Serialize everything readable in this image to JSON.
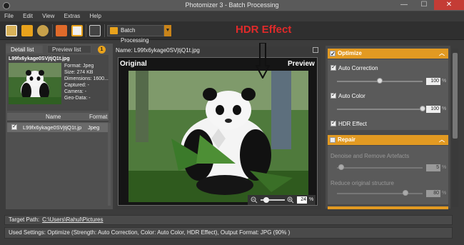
{
  "window": {
    "title": "Photomizer 3 - Batch Processing",
    "minimize": "—",
    "maximize": "☐",
    "close": "✕"
  },
  "menu": [
    "File",
    "Edit",
    "View",
    "Extras",
    "Help"
  ],
  "toolbar": {
    "batch_label": "Batch Processing",
    "batch_arrow": "▼"
  },
  "annotation": {
    "hdr_text": "HDR Effect"
  },
  "left_panel": {
    "tabs": [
      "Detail list",
      "Preview list"
    ],
    "badge": "1",
    "selected_filename": "L99fx6ykage0SVjtjQ1t.jpg",
    "details": [
      "Format: Jpeg",
      "Size: 274 KB",
      "Dimensions: 1600...",
      "Captured: -",
      "Camera: -",
      "Geo-Data: -"
    ],
    "columns": {
      "name": "Name",
      "format": "Format"
    },
    "rows": [
      {
        "name": "L99fx6ykage0SVjtjQ1t.jp",
        "format": "Jpeg",
        "checked": true
      }
    ]
  },
  "center": {
    "name_label": "Name: L99fx6ykage0SVjtjQ1t.jpg",
    "original_label": "Original",
    "preview_label": "Preview",
    "zoom_value": "24",
    "zoom_unit": "%"
  },
  "right_panel": {
    "optimize": {
      "header": "Optimize",
      "auto_correction": {
        "label": "Auto Correction",
        "value": "100",
        "unit": "%",
        "fraction": 0.5
      },
      "auto_color": {
        "label": "Auto Color",
        "value": "100",
        "unit": "%",
        "fraction": 1.0
      },
      "hdr_effect": "HDR Effect"
    },
    "repair": {
      "header": "Repair",
      "denoise": {
        "label": "Denoise and Remove Artefacts",
        "value": "5",
        "unit": "%",
        "fraction": 0.05
      },
      "reduce": {
        "label": "Reduce original structure",
        "value": "80",
        "unit": "%",
        "fraction": 0.8
      }
    }
  },
  "footer": {
    "target_label": "Target Path:",
    "target_path": "C:\\Users\\Rahul\\Pictures",
    "used_settings": "Used Settings: Optimize (Strength: Auto Correction, Color: Auto Color, HDR Effect), Output Format: JPG (90% )"
  },
  "colors": {
    "accent": "#e29a22",
    "annotation": "#e02a2a",
    "close": "#c43c35"
  }
}
